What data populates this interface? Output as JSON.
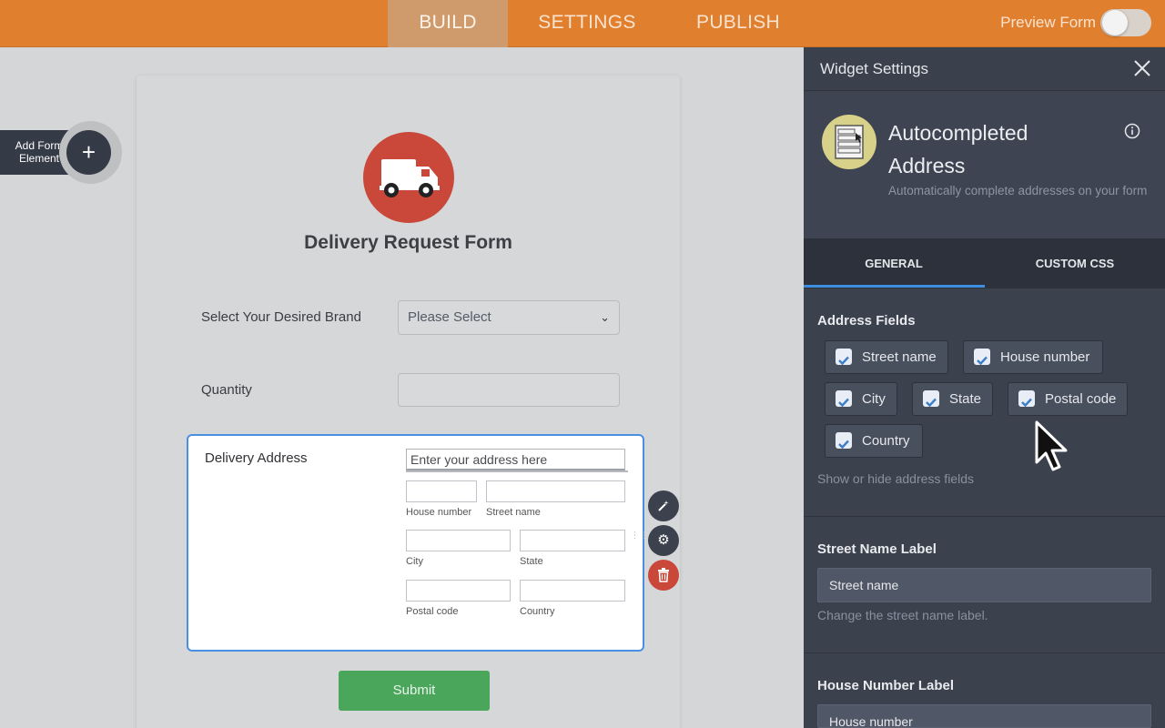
{
  "topbar": {
    "tabs": [
      {
        "label": "BUILD",
        "active": true
      },
      {
        "label": "SETTINGS",
        "active": false
      },
      {
        "label": "PUBLISH",
        "active": false
      }
    ],
    "preview_label": "Preview Form",
    "preview_on": false,
    "color": "#e07f2e"
  },
  "add_element": {
    "label": "Add Form Element",
    "icon": "plus-icon"
  },
  "form": {
    "title": "Delivery Request Form",
    "logo_icon": "delivery-truck-icon",
    "brand": {
      "label": "Select Your Desired Brand",
      "value": "Please Select"
    },
    "quantity": {
      "label": "Quantity",
      "value": ""
    },
    "address": {
      "label": "Delivery Address",
      "placeholder": "Enter your address here",
      "sub_fields": {
        "house_number": "House number",
        "street_name": "Street name",
        "city": "City",
        "state": "State",
        "postal_code": "Postal code",
        "country": "Country"
      }
    },
    "submit_label": "Submit",
    "submit_color": "#49a65a"
  },
  "field_actions": [
    "wand-icon",
    "gear-icon",
    "trash-icon"
  ],
  "panel": {
    "title": "Widget Settings",
    "widget": {
      "name": "Autocompleted Address",
      "description": "Automatically complete addresses on your form",
      "icon": "address-widget-icon"
    },
    "tabs": [
      {
        "label": "GENERAL",
        "active": true
      },
      {
        "label": "CUSTOM CSS",
        "active": false
      }
    ],
    "address_fields": {
      "heading": "Address Fields",
      "options": [
        {
          "label": "Street name",
          "checked": true
        },
        {
          "label": "House number",
          "checked": true
        },
        {
          "label": "City",
          "checked": true
        },
        {
          "label": "State",
          "checked": true
        },
        {
          "label": "Postal code",
          "checked": true
        },
        {
          "label": "Country",
          "checked": true
        }
      ],
      "hint": "Show or hide address fields"
    },
    "street_label": {
      "heading": "Street Name Label",
      "value": "Street name",
      "hint": "Change the street name label."
    },
    "house_label": {
      "heading": "House Number Label",
      "value": "House number"
    }
  }
}
